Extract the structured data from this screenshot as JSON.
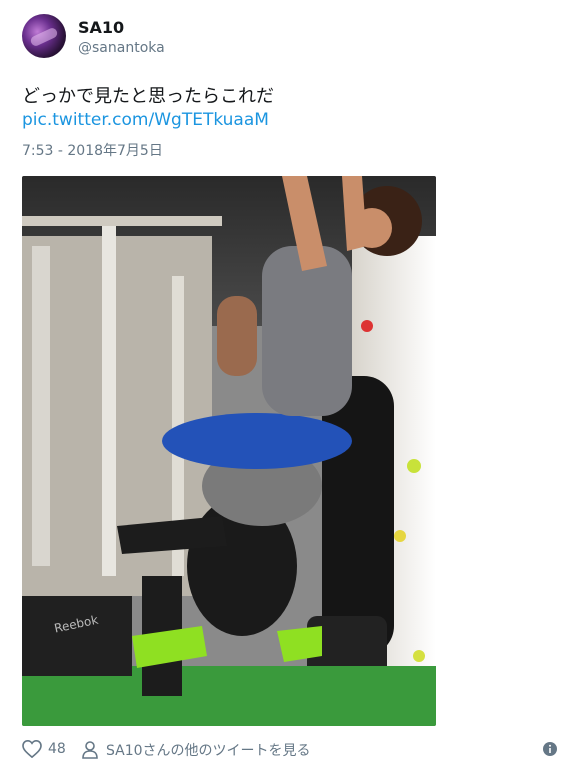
{
  "author": {
    "display_name": "SA10",
    "handle": "@sanantoka"
  },
  "tweet": {
    "text": "どっかで見たと思ったらこれだ",
    "link": "pic.twitter.com/WgTETkuaaM",
    "timestamp": "7:53 - 2018年7月5日"
  },
  "photo": {
    "brand_text": "Reebok"
  },
  "footer": {
    "like_count": "48",
    "more_tweets_label": "SA10さんの他のツイートを見る"
  },
  "icons": [
    "heart-icon",
    "person-icon",
    "info-icon"
  ]
}
